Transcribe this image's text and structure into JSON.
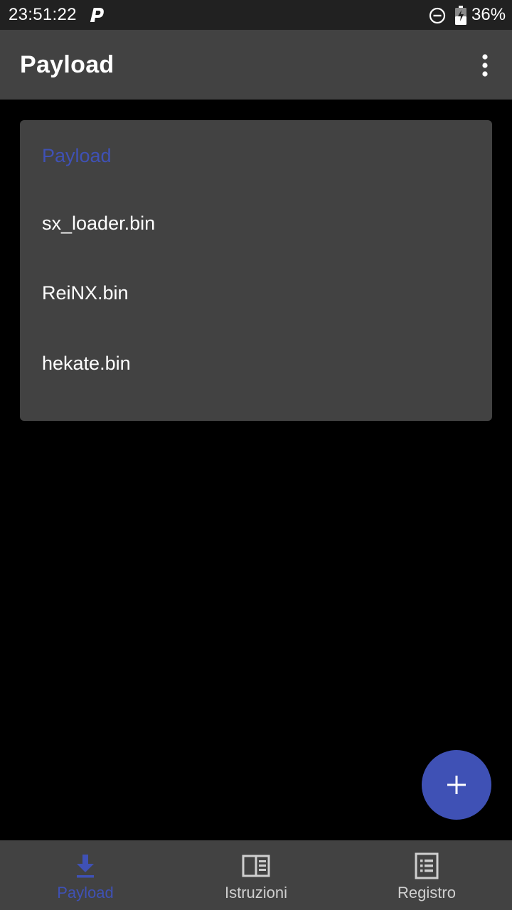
{
  "status_bar": {
    "time": "23:51:22",
    "battery": "36%",
    "notification_icon": "p-icon",
    "dnd_icon": "do-not-disturb-icon",
    "battery_icon": "battery-charging-icon"
  },
  "app_bar": {
    "title": "Payload",
    "menu_icon": "more-vert-icon"
  },
  "payload_card": {
    "header": "Payload",
    "items": [
      {
        "label": "sx_loader.bin"
      },
      {
        "label": "ReiNX.bin"
      },
      {
        "label": "hekate.bin"
      }
    ]
  },
  "fab": {
    "icon": "add-icon"
  },
  "bottom_nav": {
    "items": [
      {
        "label": "Payload",
        "icon": "download-icon",
        "active": true
      },
      {
        "label": "Istruzioni",
        "icon": "book-icon",
        "active": false
      },
      {
        "label": "Registro",
        "icon": "list-icon",
        "active": false
      }
    ]
  },
  "colors": {
    "accent": "#3f51b5",
    "surface": "#424242",
    "background": "#000000",
    "status_bar": "#212121"
  }
}
